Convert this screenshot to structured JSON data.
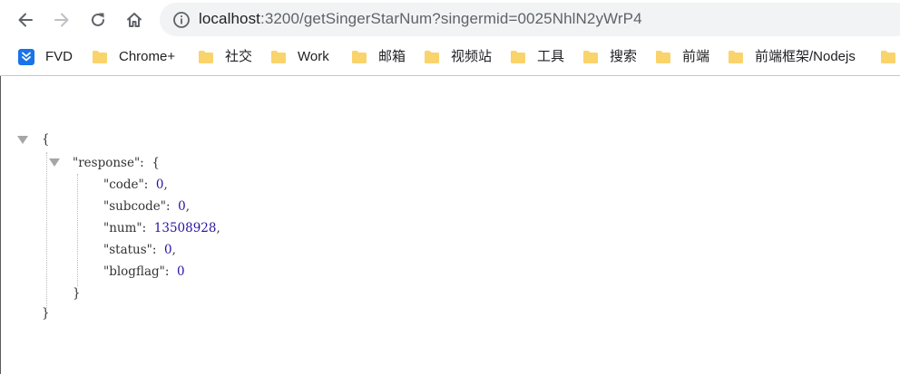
{
  "browser": {
    "url_host": "localhost",
    "url_rest": ":3200/getSingerStarNum?singermid=0025NhlN2yWrP4"
  },
  "bookmarks": [
    {
      "label": "FVD",
      "icon": "fvd-download-icon",
      "color": "#1a73e8"
    },
    {
      "label": "Chrome+",
      "icon": "folder-icon",
      "color": "#f9d36b"
    },
    {
      "label": "社交",
      "icon": "folder-icon",
      "color": "#f9d36b"
    },
    {
      "label": "Work",
      "icon": "folder-icon",
      "color": "#f9d36b"
    },
    {
      "label": "邮箱",
      "icon": "folder-icon",
      "color": "#f9d36b"
    },
    {
      "label": "视频站",
      "icon": "folder-icon",
      "color": "#f9d36b"
    },
    {
      "label": "工具",
      "icon": "folder-icon",
      "color": "#f9d36b"
    },
    {
      "label": "搜索",
      "icon": "folder-icon",
      "color": "#f9d36b"
    },
    {
      "label": "前端",
      "icon": "folder-icon",
      "color": "#f9d36b"
    },
    {
      "label": "前端框架/Nodejs",
      "icon": "folder-icon",
      "color": "#f9d36b"
    },
    {
      "label": "",
      "icon": "folder-icon",
      "color": "#f9d36b"
    }
  ],
  "json": {
    "open_brace": "{",
    "close_brace": "}",
    "response_key": "\"response\":",
    "response_open": "{",
    "response_close": "}",
    "fields": [
      {
        "key": "\"code\":",
        "value": "0",
        "sep": ","
      },
      {
        "key": "\"subcode\":",
        "value": "0",
        "sep": ","
      },
      {
        "key": "\"num\":",
        "value": "13508928",
        "sep": ","
      },
      {
        "key": "\"status\":",
        "value": "0",
        "sep": ","
      },
      {
        "key": "\"blogflag\":",
        "value": "0",
        "sep": ""
      }
    ]
  },
  "colors": {
    "number": "#2a12a0",
    "folder": "#f9d36b",
    "fvd": "#1a73e8"
  }
}
